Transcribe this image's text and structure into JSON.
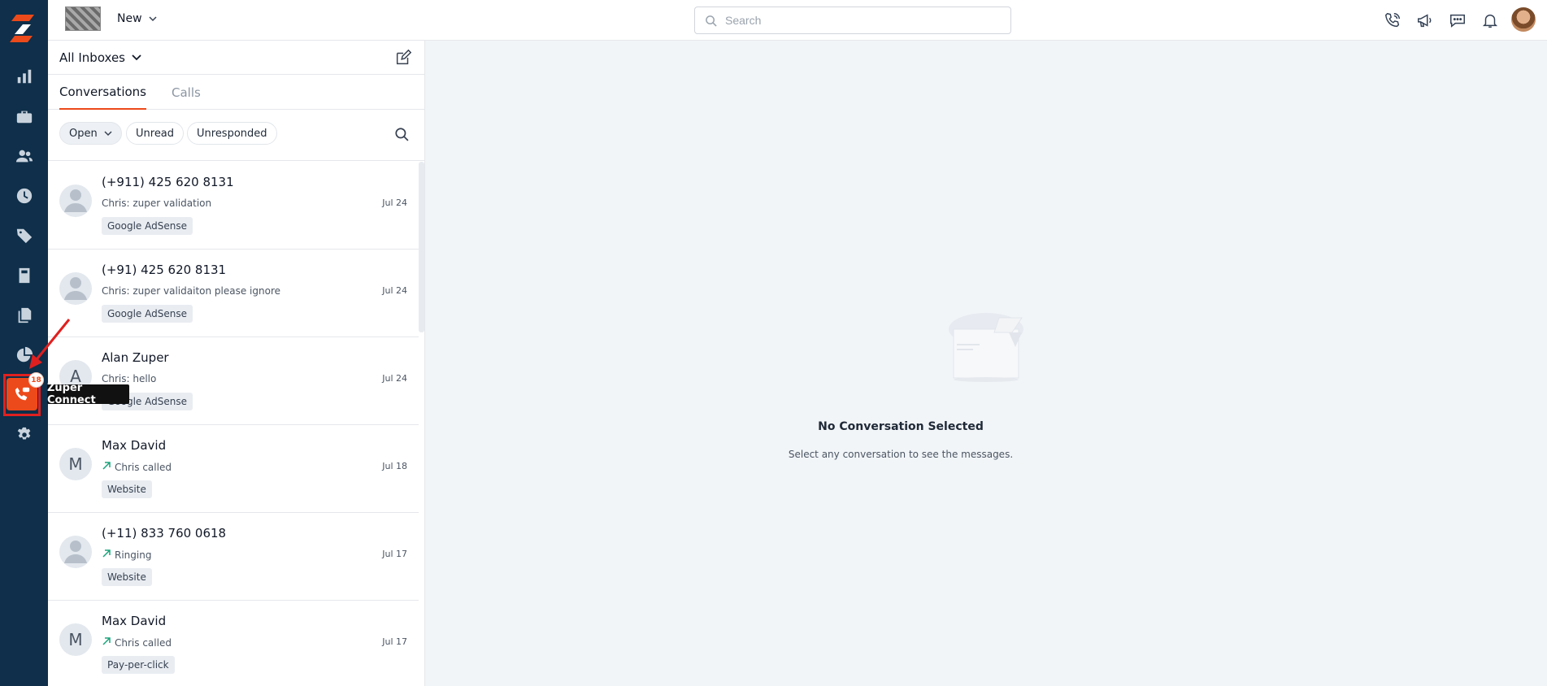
{
  "topbar": {
    "new_label": "New",
    "search_placeholder": "Search"
  },
  "rail": {
    "items": [
      "dashboard-icon",
      "jobs-icon",
      "customers-icon",
      "timesheet-icon",
      "products-icon",
      "invoices-icon",
      "documents-icon",
      "reports-icon",
      "zuper-connect-icon",
      "settings-icon"
    ],
    "active_badge": "18",
    "tooltip": "Zuper Connect"
  },
  "panel": {
    "inbox_title": "All Inboxes",
    "tabs": [
      {
        "label": "Conversations"
      },
      {
        "label": "Calls"
      }
    ],
    "filters": {
      "status": "Open",
      "unread": "Unread",
      "unresponded": "Unresponded"
    },
    "conversations": [
      {
        "name": "(+911) 425 620 8131",
        "preview": "Chris: zuper validation",
        "tag": "Google AdSense",
        "date": "Jul 24",
        "avatar": ""
      },
      {
        "name": "(+91) 425 620 8131",
        "preview": "Chris: zuper validaiton please ignore",
        "tag": "Google AdSense",
        "date": "Jul 24",
        "avatar": ""
      },
      {
        "name": "Alan Zuper",
        "preview": "Chris: hello",
        "tag": "Google AdSense",
        "date": "Jul 24",
        "avatar": "A"
      },
      {
        "name": "Max David",
        "preview": "Chris called",
        "tag": "Website",
        "date": "Jul 18",
        "avatar": "M"
      },
      {
        "name": "(+11) 833 760 0618",
        "preview": "Ringing",
        "tag": "Website",
        "date": "Jul 17",
        "avatar": ""
      },
      {
        "name": "Max David",
        "preview": "Chris called",
        "tag": "Pay-per-click",
        "date": "Jul 17",
        "avatar": "M"
      }
    ]
  },
  "empty_state": {
    "title": "No Conversation Selected",
    "subtitle": "Select any conversation to see the messages."
  },
  "colors": {
    "accent": "#ec4a1a",
    "rail": "#0f2f4a",
    "highlight": "#e0201f"
  }
}
